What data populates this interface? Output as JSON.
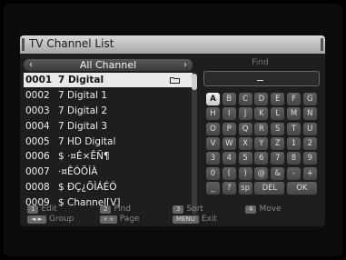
{
  "window": {
    "title": "TV Channel List"
  },
  "group": {
    "prev_icon": "chevron-left-icon",
    "title": "All Channel",
    "next_icon": "chevron-right-icon"
  },
  "channels": [
    {
      "num": "0001",
      "name": "7 Digital",
      "selected": true,
      "icon": "folder-icon"
    },
    {
      "num": "0002",
      "name": "7 Digital 1"
    },
    {
      "num": "0003",
      "name": "7 Digital 2"
    },
    {
      "num": "0004",
      "name": "7 Digital 3"
    },
    {
      "num": "0005",
      "name": "7 HD Digital"
    },
    {
      "num": "0006",
      "name": "$ ·¤É×ÊÑ¶"
    },
    {
      "num": "0007",
      "name": "·¤ÊÓÕÍÀ"
    },
    {
      "num": "0008",
      "name": "$ ÐÇ¿ÕÌÁÉÓ"
    },
    {
      "num": "0009",
      "name": "$ Channel[V]"
    }
  ],
  "find": {
    "label": "Find",
    "value": "_",
    "keys": [
      [
        "A",
        "B",
        "C",
        "D",
        "E",
        "F",
        "G"
      ],
      [
        "H",
        "I",
        "J",
        "K",
        "L",
        "M",
        "N"
      ],
      [
        "O",
        "P",
        "Q",
        "R",
        "S",
        "T",
        "U"
      ],
      [
        "V",
        "W",
        "X",
        "Y",
        "Z",
        "1",
        "2"
      ],
      [
        "3",
        "4",
        "5",
        "6",
        "7",
        "8",
        "9"
      ],
      [
        "0",
        "(",
        ")",
        "@",
        "&",
        "-",
        "+"
      ],
      [
        "_",
        "?",
        "sp",
        "DEL",
        "OK"
      ]
    ],
    "active_key": "A"
  },
  "help": [
    {
      "key": "1",
      "label": "Edit"
    },
    {
      "key": "2",
      "label": "Find"
    },
    {
      "key": "3",
      "label": "Sort"
    },
    {
      "key": "4",
      "label": "Move"
    },
    {
      "key": "◄ ►",
      "label": "Group"
    },
    {
      "key": "«  »",
      "label": "Page"
    },
    {
      "key": "MENU",
      "label": "Exit"
    }
  ],
  "colors": {
    "selected_row": "#e9e9e9",
    "title_bar": "#c0c0c0",
    "background": "#1e1e1e"
  }
}
